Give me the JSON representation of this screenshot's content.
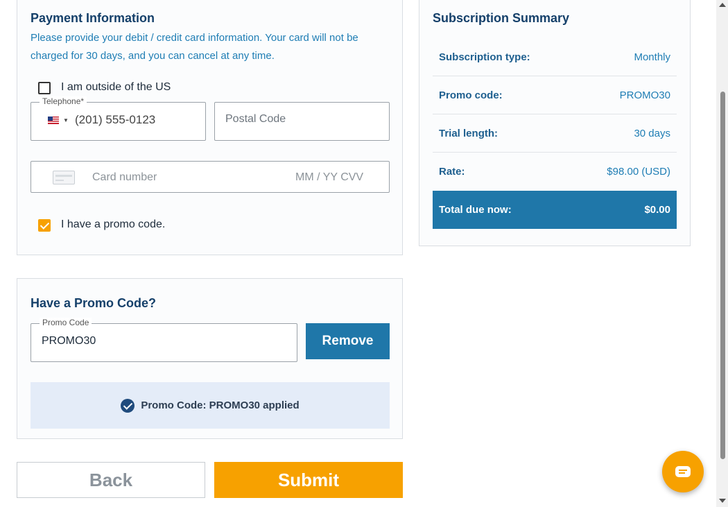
{
  "payment": {
    "title": "Payment Information",
    "description": "Please provide your debit / credit card information. Your card will not be charged for 30 days, and you can cancel at any time.",
    "outside_us_label": "I am outside of the US",
    "outside_us_checked": false,
    "telephone": {
      "label": "Telephone*",
      "value": "(201) 555-0123",
      "country": "US"
    },
    "postal_code_placeholder": "Postal Code",
    "card": {
      "number_placeholder": "Card number",
      "expiry_cvv_placeholder": "MM / YY CVV"
    },
    "promo_checkbox_label": "I have a promo code.",
    "promo_checked": true
  },
  "promo": {
    "title": "Have a Promo Code?",
    "field_label": "Promo Code",
    "field_value": "PROMO30",
    "remove_label": "Remove",
    "applied_message": "Promo Code: PROMO30 applied"
  },
  "actions": {
    "back_label": "Back",
    "submit_label": "Submit"
  },
  "summary": {
    "title": "Subscription Summary",
    "rows": [
      {
        "label": "Subscription type:",
        "value": "Monthly"
      },
      {
        "label": "Promo code:",
        "value": "PROMO30"
      },
      {
        "label": "Trial length:",
        "value": "30 days"
      },
      {
        "label": "Rate:",
        "value": "$98.00 (USD)"
      }
    ],
    "total": {
      "label": "Total due now:",
      "value": "$0.00"
    }
  },
  "colors": {
    "brand_blue": "#1f77a9",
    "heading_navy": "#15406a",
    "accent_orange": "#f7a100",
    "applied_bg": "#e4ecf8"
  },
  "icons": {
    "flag": "us-flag-icon",
    "card": "credit-card-icon",
    "applied": "check-circle-icon",
    "chat": "chat-icon"
  }
}
